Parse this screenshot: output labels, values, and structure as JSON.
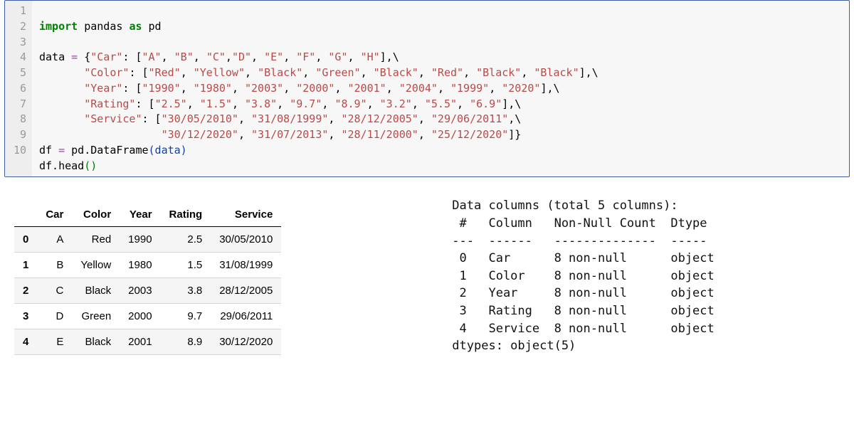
{
  "code": {
    "lines": 10,
    "line1": {
      "kw_import": "import",
      "mod": "pandas",
      "kw_as": "as",
      "alias": "pd"
    },
    "line3_lead": "data ",
    "eq": "=",
    "brace_open": " {",
    "l3": {
      "key": "\"Car\"",
      "vals": [
        "\"A\"",
        "\"B\"",
        "\"C\"",
        "\"D\"",
        "\"E\"",
        "\"F\"",
        "\"G\"",
        "\"H\""
      ]
    },
    "l4": {
      "key": "\"Color\"",
      "vals": [
        "\"Red\"",
        "\"Yellow\"",
        "\"Black\"",
        "\"Green\"",
        "\"Black\"",
        "\"Red\"",
        "\"Black\"",
        "\"Black\""
      ]
    },
    "l5": {
      "key": "\"Year\"",
      "vals": [
        "\"1990\"",
        "\"1980\"",
        "\"2003\"",
        "\"2000\"",
        "\"2001\"",
        "\"2004\"",
        "\"1999\"",
        "\"2020\""
      ]
    },
    "l6": {
      "key": "\"Rating\"",
      "vals": [
        "\"2.5\"",
        "\"1.5\"",
        "\"3.8\"",
        "\"9.7\"",
        "\"8.9\"",
        "\"3.2\"",
        "\"5.5\"",
        "\"6.9\""
      ]
    },
    "l7": {
      "key": "\"Service\"",
      "vals_a": [
        "\"30/05/2010\"",
        "\"31/08/1999\"",
        "\"28/12/2005\"",
        "\"29/06/2011\""
      ],
      "vals_b": [
        "\"30/12/2020\"",
        "\"31/07/2013\"",
        "\"28/11/2000\"",
        "\"25/12/2020\""
      ]
    },
    "l9": {
      "lhs": "df ",
      "eq": "=",
      "rhs_a": " pd.DataFrame",
      "rhs_b": "(data)"
    },
    "l10": {
      "a": "df.head",
      "b": "()"
    }
  },
  "df": {
    "columns": [
      "Car",
      "Color",
      "Year",
      "Rating",
      "Service"
    ],
    "index": [
      "0",
      "1",
      "2",
      "3",
      "4"
    ],
    "rows": [
      [
        "A",
        "Red",
        "1990",
        "2.5",
        "30/05/2010"
      ],
      [
        "B",
        "Yellow",
        "1980",
        "1.5",
        "31/08/1999"
      ],
      [
        "C",
        "Black",
        "2003",
        "3.8",
        "28/12/2005"
      ],
      [
        "D",
        "Green",
        "2000",
        "9.7",
        "29/06/2011"
      ],
      [
        "E",
        "Black",
        "2001",
        "8.9",
        "30/12/2020"
      ]
    ]
  },
  "info": {
    "header": "Data columns (total 5 columns):",
    "colhdr": " #   Column   Non-Null Count  Dtype ",
    "sep": "---  ------   --------------  ----- ",
    "rows": [
      " 0   Car      8 non-null      object",
      " 1   Color    8 non-null      object",
      " 2   Year     8 non-null      object",
      " 3   Rating   8 non-null      object",
      " 4   Service  8 non-null      object"
    ],
    "footer": "dtypes: object(5)"
  }
}
